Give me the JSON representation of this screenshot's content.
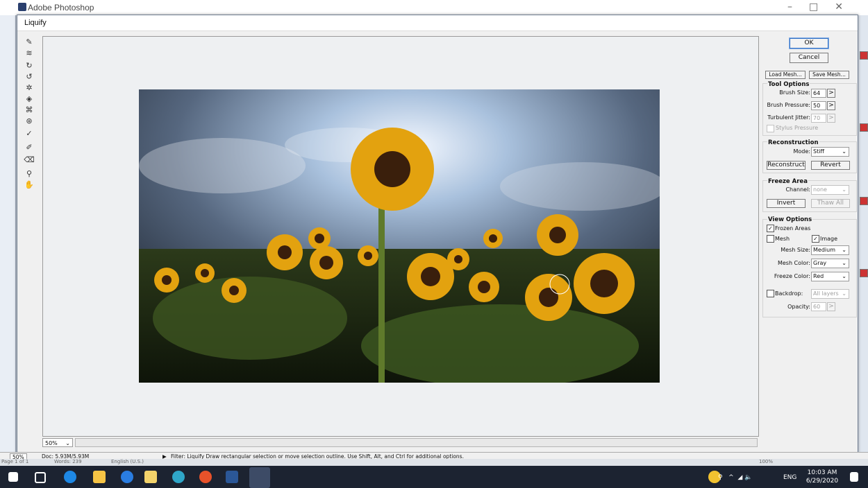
{
  "app": {
    "title": "Adobe Photoshop"
  },
  "dialog": {
    "title": "Liquify"
  },
  "buttons": {
    "ok": "OK",
    "cancel": "Cancel",
    "load_mesh": "Load Mesh...",
    "save_mesh": "Save Mesh..."
  },
  "tool_options": {
    "title": "Tool Options",
    "brush_size_label": "Brush Size:",
    "brush_size": "64",
    "brush_pressure_label": "Brush Pressure:",
    "brush_pressure": "50",
    "turbulent_jitter_label": "Turbulent Jitter:",
    "turbulent_jitter": "70",
    "stylus_pressure_label": "Stylus Pressure"
  },
  "reconstruction": {
    "title": "Reconstruction",
    "mode_label": "Mode:",
    "mode": "Stiff",
    "reconstruct": "Reconstruct",
    "revert": "Revert"
  },
  "freeze_area": {
    "title": "Freeze Area",
    "channel_label": "Channel:",
    "channel": "none",
    "invert": "Invert",
    "thaw_all": "Thaw All"
  },
  "view_options": {
    "title": "View Options",
    "frozen_areas": "Frozen Areas",
    "mesh": "Mesh",
    "image": "Image",
    "mesh_size_label": "Mesh Size:",
    "mesh_size": "Medium",
    "mesh_color_label": "Mesh Color:",
    "mesh_color": "Gray",
    "freeze_color_label": "Freeze Color:",
    "freeze_color": "Red",
    "backdrop_label": "Backdrop:",
    "backdrop": "All layers",
    "opacity_label": "Opacity:",
    "opacity": "60"
  },
  "zoom": {
    "value": "50%"
  },
  "status": {
    "zoom": "50%",
    "doc": "Doc: 5.93M/5.93M",
    "message": "Filter: Liquify   Draw rectangular selection or move selection outline.  Use Shift, Alt, and Ctrl for additional options."
  },
  "word_status": {
    "page": "Page 1 of 1",
    "words": "Words: 239",
    "language": "English (U.S.)",
    "zoom": "100%"
  },
  "taskbar": {
    "time": "10:03 AM",
    "date": "6/29/2020",
    "lang": "ENG"
  },
  "colors": {
    "taskbar": "#1c2331",
    "dialog_bg": "#f0f0f0",
    "default_button_border": "#2f6fc4"
  }
}
